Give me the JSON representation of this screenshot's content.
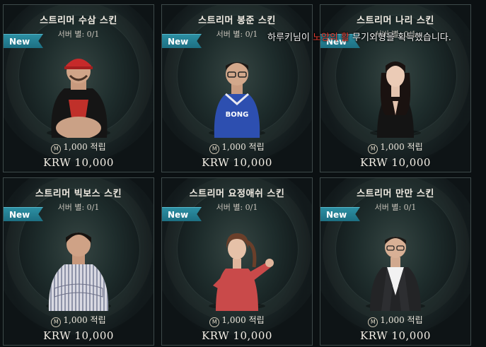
{
  "notification": {
    "before": "하루키님이 ",
    "item": "노양의 활",
    "after": " 무기외형을 획득했습니다."
  },
  "cards": [
    {
      "title": "스트리머 수삼 스킨",
      "server": "서버 별: 0/1",
      "badge": "New",
      "points": "1,000 적립",
      "coin": "M",
      "price": "KRW 10,000",
      "figure": "red-cap-streamer"
    },
    {
      "title": "스트리머 봉준 스킨",
      "server": "서버 별: 0/1",
      "badge": "New",
      "points": "1,000 적립",
      "coin": "M",
      "price": "KRW 10,000",
      "figure": "blue-jersey-streamer"
    },
    {
      "title": "스트리머 나리 스킨",
      "server": "서버 별: 0/1",
      "badge": "New",
      "points": "1,000 적립",
      "coin": "M",
      "price": "KRW 10,000",
      "figure": "black-dress-streamer"
    },
    {
      "title": "스트리머 빅보스 스킨",
      "server": "서버 별: 0/1",
      "badge": "New",
      "points": "1,000 적립",
      "coin": "M",
      "price": "KRW 10,000",
      "figure": "striped-pajama-streamer"
    },
    {
      "title": "스트리머 요정애쉬 스킨",
      "server": "서버 별: 0/1",
      "badge": "New",
      "points": "1,000 적립",
      "coin": "M",
      "price": "KRW 10,000",
      "figure": "pink-jacket-streamer"
    },
    {
      "title": "스트리머 만만 스킨",
      "server": "서버 별: 0/1",
      "badge": "New",
      "points": "1,000 적립",
      "coin": "M",
      "price": "KRW 10,000",
      "figure": "suit-streamer"
    }
  ],
  "colors": {
    "badge": "#2c8fa3",
    "highlight": "#e33b2f",
    "card_border": "#3e4a4a"
  }
}
